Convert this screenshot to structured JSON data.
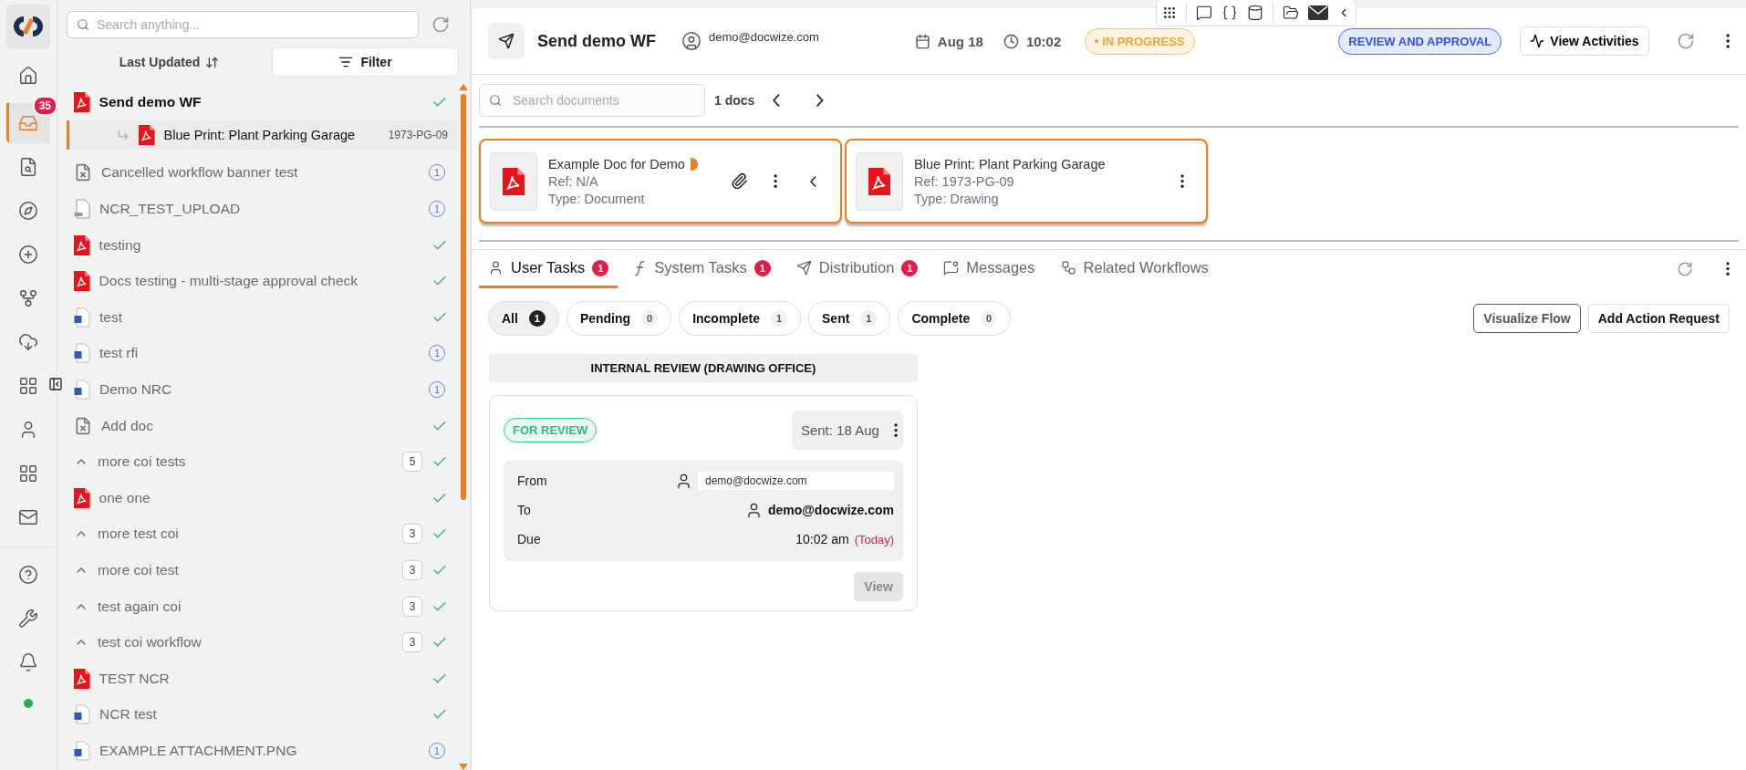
{
  "nav": {
    "items": [
      {
        "selected": false
      },
      {
        "selected": true,
        "badge": "35"
      },
      {
        "selected": false
      },
      {
        "selected": false
      },
      {
        "selected": false
      },
      {
        "selected": false
      },
      {
        "selected": false
      },
      {
        "selected": false
      },
      {
        "selected": false
      },
      {
        "selected": false
      },
      {
        "selected": false
      }
    ],
    "bottom": [
      {
        "selected": false
      },
      {
        "selected": false
      },
      {
        "selected": false
      }
    ],
    "online": true
  },
  "list": {
    "search": {
      "placeholder": "Search anything..."
    },
    "sort": "Last Updated",
    "filter": "Filter",
    "items": [
      {
        "title": "Send demo WF",
        "kind": "pdf",
        "done": true,
        "selected": true,
        "children": [
          {
            "title": "Blue Print: Plant Parking Garage",
            "kind": "pdf",
            "ref": "1973-PG-09",
            "selected": true
          }
        ]
      },
      {
        "title": "Cancelled workflow banner test",
        "kind": "cancelled",
        "done": false,
        "badge": "1",
        "selected": false
      },
      {
        "title": "NCR_TEST_UPLOAD",
        "kind": "txt",
        "done": false,
        "badge": "1",
        "selected": false
      },
      {
        "title": "testing",
        "kind": "pdf",
        "done": true,
        "selected": false
      },
      {
        "title": "Docs testing - multi-stage approval check",
        "kind": "pdf",
        "done": true,
        "selected": false
      },
      {
        "title": "test",
        "kind": "word",
        "done": true,
        "selected": false
      },
      {
        "title": "test rfi",
        "kind": "word",
        "done": false,
        "badge": "1",
        "selected": false
      },
      {
        "title": "Demo NRC",
        "kind": "word",
        "done": false,
        "badge": "1",
        "selected": false
      },
      {
        "title": "Add doc",
        "kind": "cancelled",
        "done": true,
        "selected": false
      },
      {
        "title": "more coi tests",
        "kind": "group",
        "done": true,
        "count": "5",
        "selected": false
      },
      {
        "title": "one one",
        "kind": "pdf",
        "done": true,
        "selected": false
      },
      {
        "title": "more test coi",
        "kind": "group",
        "done": true,
        "count": "3",
        "selected": false
      },
      {
        "title": "more coi test",
        "kind": "group",
        "done": true,
        "count": "3",
        "selected": false
      },
      {
        "title": "test again coi",
        "kind": "group",
        "done": true,
        "count": "3",
        "selected": false
      },
      {
        "title": "test coi workflow",
        "kind": "group",
        "done": true,
        "count": "3",
        "selected": false
      },
      {
        "title": "TEST NCR",
        "kind": "pdf",
        "done": true,
        "selected": false
      },
      {
        "title": "NCR test",
        "kind": "word",
        "done": true,
        "selected": false
      },
      {
        "title": "EXAMPLE ATTACHMENT.PNG",
        "kind": "word",
        "done": false,
        "badge": "1",
        "selected": false
      }
    ]
  },
  "header": {
    "title": "Send demo WF",
    "user": "demo@docwize.com",
    "date": "Aug 18",
    "time": "10:02",
    "status": "IN PROGRESS",
    "stage": "REVIEW AND APPROVAL",
    "activities": "View Activities"
  },
  "documents": {
    "search": {
      "placeholder": "Search documents"
    },
    "count": "1 docs",
    "cards": [
      {
        "title": "Example Doc for Demo",
        "ref": "Ref: N/A",
        "type": "Type: Document",
        "attachment": true,
        "collapsible": true
      },
      {
        "title": "Blue Print: Plant Parking Garage",
        "ref": "Ref: 1973-PG-09",
        "type": "Type: Drawing",
        "attachment": false,
        "collapsible": false
      }
    ]
  },
  "tabs": [
    {
      "label": "User Tasks",
      "badge": "1",
      "selected": true
    },
    {
      "label": "System Tasks",
      "badge": "1",
      "selected": false
    },
    {
      "label": "Distribution",
      "badge": "1",
      "selected": false
    },
    {
      "label": "Messages",
      "selected": false
    },
    {
      "label": "Related Workflows",
      "selected": false
    }
  ],
  "filters": [
    {
      "label": "All",
      "count": "1",
      "selected": true
    },
    {
      "label": "Pending",
      "count": "0",
      "selected": false
    },
    {
      "label": "Incomplete",
      "count": "1",
      "selected": false
    },
    {
      "label": "Sent",
      "count": "1",
      "selected": false
    },
    {
      "label": "Complete",
      "count": "0",
      "selected": false
    }
  ],
  "actions": [
    "Visualize Flow",
    "Add Action Request"
  ],
  "stage_title": "INTERNAL REVIEW (DRAWING OFFICE)",
  "task": {
    "status": "FOR REVIEW",
    "sent": "Sent: 18 Aug",
    "rows": [
      {
        "label": "From",
        "value": "demo@docwize.com",
        "kind": "field"
      },
      {
        "label": "To",
        "value": "demo@docwize.com",
        "kind": "person"
      },
      {
        "label": "Due",
        "value": "10:02 am",
        "note": "(Today)",
        "kind": "time"
      }
    ],
    "view": {
      "label": "View",
      "disabled": true
    }
  }
}
